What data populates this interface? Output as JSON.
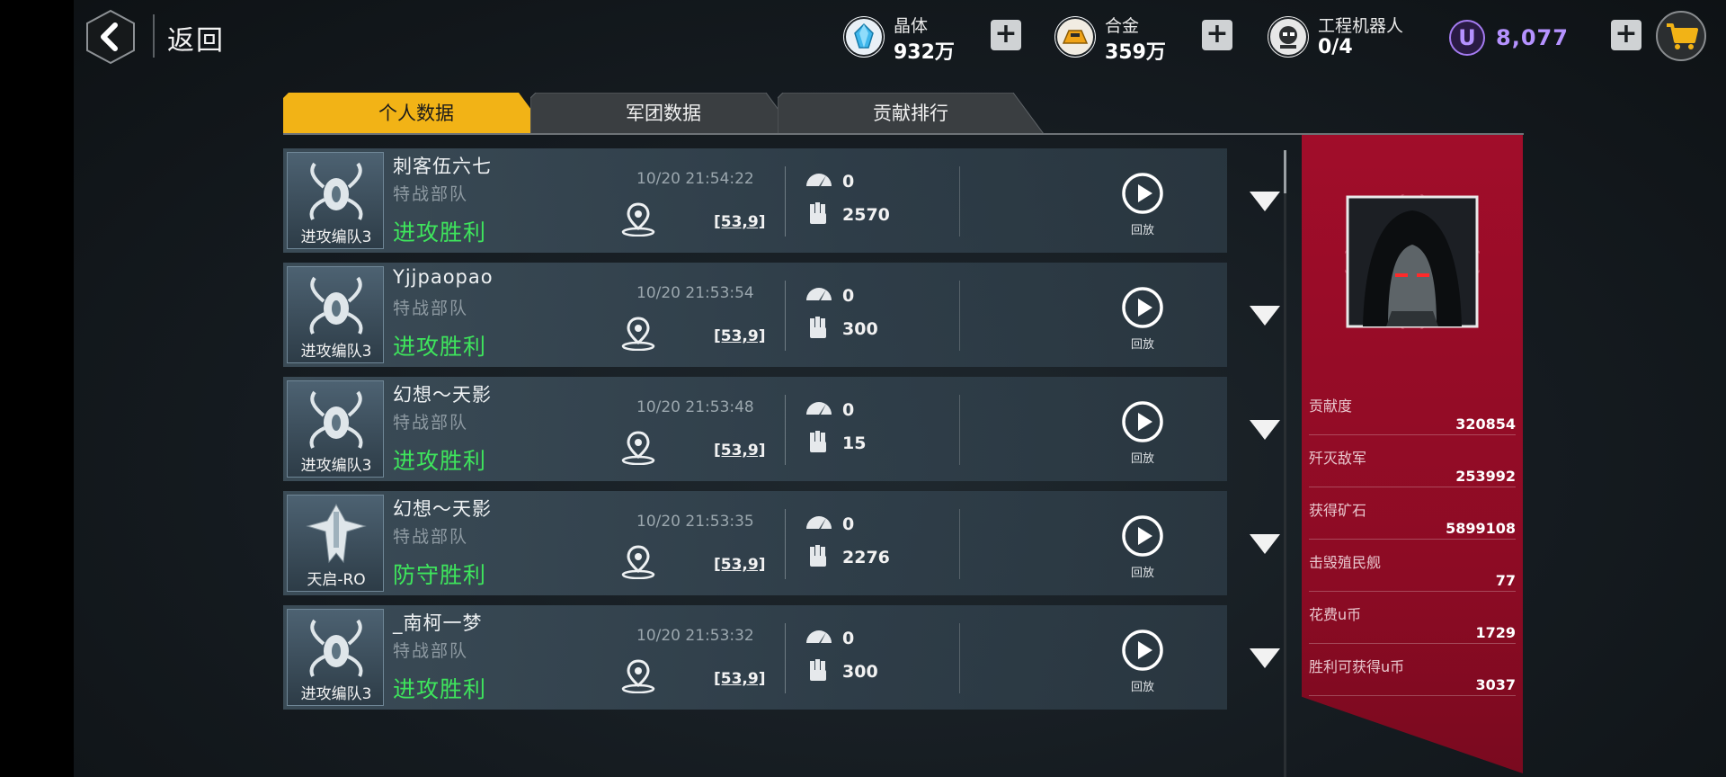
{
  "header": {
    "back_label": "返回",
    "resources": [
      {
        "name": "晶体",
        "value": "932万"
      },
      {
        "name": "合金",
        "value": "359万"
      },
      {
        "name": "工程机器人",
        "value": "0/4"
      }
    ],
    "u_currency": {
      "symbol": "U",
      "value": "8,077"
    },
    "plus_label": "+"
  },
  "tabs": [
    {
      "label": "个人数据",
      "active": true
    },
    {
      "label": "军团数据",
      "active": false
    },
    {
      "label": "贡献排行",
      "active": false
    }
  ],
  "records": [
    {
      "thumb_label": "进攻编队3",
      "thumb_icon": "spider-mech-icon",
      "name": "刺客伍六七",
      "team": "特战部队",
      "result": "进攻胜利",
      "time": "10/20 21:54:22",
      "coord": "[53,9]",
      "stat1": "0",
      "stat2": "2570",
      "replay_label": "回放"
    },
    {
      "thumb_label": "进攻编队3",
      "thumb_icon": "spider-mech-icon",
      "name": "Yjjpaopao",
      "team": "特战部队",
      "result": "进攻胜利",
      "time": "10/20 21:53:54",
      "coord": "[53,9]",
      "stat1": "0",
      "stat2": "300",
      "replay_label": "回放"
    },
    {
      "thumb_label": "进攻编队3",
      "thumb_icon": "spider-mech-icon",
      "name": "幻想～天影",
      "team": "特战部队",
      "result": "进攻胜利",
      "time": "10/20 21:53:48",
      "coord": "[53,9]",
      "stat1": "0",
      "stat2": "15",
      "replay_label": "回放"
    },
    {
      "thumb_label": "天启-RO",
      "thumb_icon": "warship-icon",
      "name": "幻想～天影",
      "team": "特战部队",
      "result": "防守胜利",
      "time": "10/20 21:53:35",
      "coord": "[53,9]",
      "stat1": "0",
      "stat2": "2276",
      "replay_label": "回放"
    },
    {
      "thumb_label": "进攻编队3",
      "thumb_icon": "spider-mech-icon",
      "name": "_南柯一梦",
      "team": "特战部队",
      "result": "进攻胜利",
      "time": "10/20 21:53:32",
      "coord": "[53,9]",
      "stat1": "0",
      "stat2": "300",
      "replay_label": "回放"
    }
  ],
  "profile_stats": [
    {
      "label": "贡献度",
      "value": "320854"
    },
    {
      "label": "歼灭敌军",
      "value": "253992"
    },
    {
      "label": "获得矿石",
      "value": "5899108"
    },
    {
      "label": "击毁殖民舰",
      "value": "77"
    },
    {
      "label": "花费u币",
      "value": "1729"
    },
    {
      "label": "胜利可获得u币",
      "value": "3037"
    }
  ],
  "colors": {
    "tab_active": "#f2b316",
    "tab_inactive": "#3a3e41",
    "victory_green": "#3ee55c",
    "panel_red": "#a10d2a",
    "u_purple": "#b592ff"
  }
}
